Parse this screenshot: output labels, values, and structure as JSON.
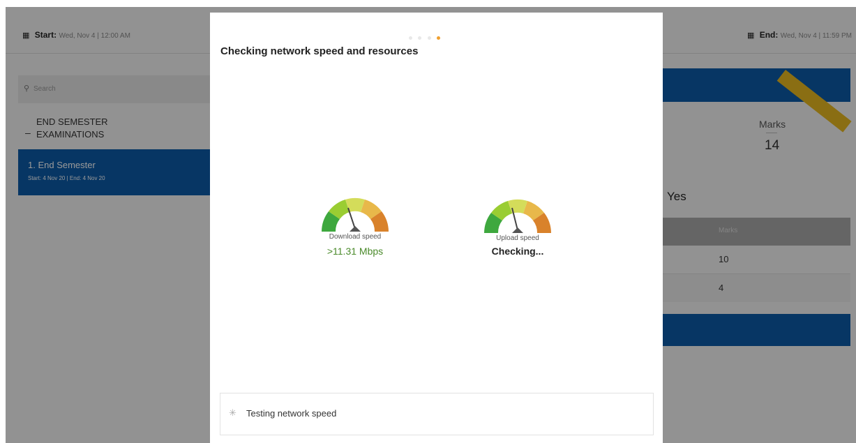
{
  "header": {
    "start_label": "Start:",
    "start_value": "Wed, Nov 4 | 12:00 AM",
    "end_label": "End:",
    "end_value": "Wed, Nov 4 | 11:59 PM"
  },
  "sidebar": {
    "search_placeholder": "Search",
    "section_title": "END SEMESTER EXAMINATIONS",
    "exam": {
      "name": "1. End Semester",
      "dates": "Start: 4 Nov 20 | End: 4 Nov 20"
    }
  },
  "right_panel": {
    "marks_label": "Marks",
    "marks_value": "14",
    "yes_label": "Yes",
    "table_header": "Marks",
    "rows": [
      "10",
      "4"
    ]
  },
  "modal": {
    "title": "Checking network speed and resources",
    "step_count": 4,
    "active_step": 4,
    "download": {
      "label": "Download speed",
      "value": ">11.31 Mbps"
    },
    "upload": {
      "label": "Upload speed",
      "value": "Checking..."
    },
    "status_text": "Testing network speed"
  },
  "colors": {
    "primary": "#0d5aa7",
    "ribbon": "#e6b821",
    "dot_active": "#f0a030",
    "download_value": "#4a8a2a"
  }
}
